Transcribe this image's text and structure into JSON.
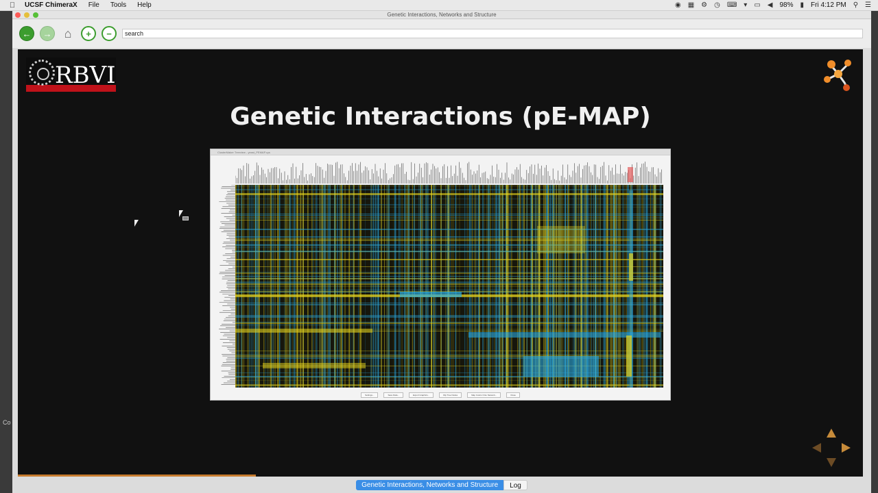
{
  "menubar": {
    "app_name": "UCSF ChimeraX",
    "menus": [
      "File",
      "Tools",
      "Help"
    ],
    "battery": "98%",
    "clock": "Fri 4:12 PM"
  },
  "window": {
    "title": "Genetic Interactions, Networks and Structure"
  },
  "toolbar": {
    "search_value": "search"
  },
  "slide": {
    "logo_text": "RBVI",
    "title": "Genetic Interactions (pE-MAP)",
    "pemap": {
      "window_title": "ClusterMaker Treeview - yeast_PEMAP.cys",
      "buttons": [
        "Settings...",
        "Save Data...",
        "Export Graphics...",
        "Flip Tree Nodes",
        "Map Colors Onto Network...",
        "Close"
      ]
    }
  },
  "tabs": [
    {
      "label": "Genetic Interactions, Networks and Structure",
      "active": true
    },
    {
      "label": "Log",
      "active": false
    }
  ],
  "colors": {
    "positive": "#e6d31c",
    "negative": "#2aa9e0",
    "accent": "#c78b3a",
    "tab_active": "#3a8ee6"
  },
  "background_fragments": {
    "left_edge": "Co"
  }
}
